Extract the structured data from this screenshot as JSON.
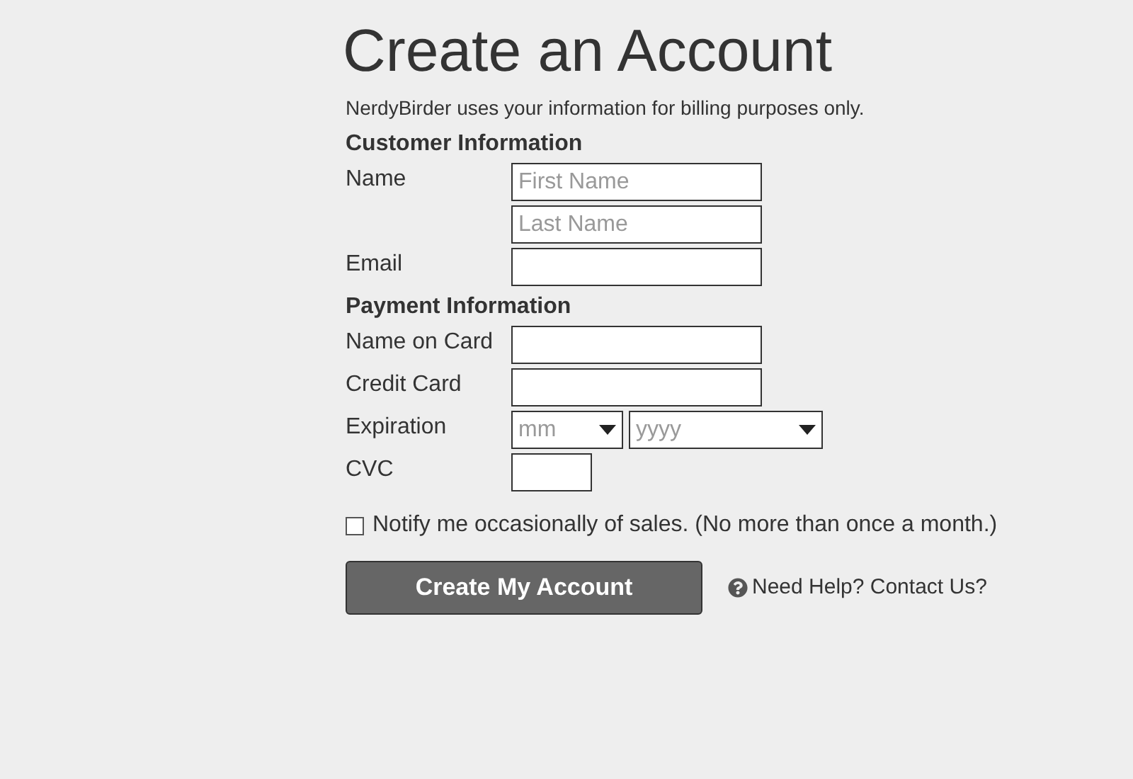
{
  "title": "Create an Account",
  "intro": "NerdyBirder uses your information for billing purposes only.",
  "sections": [
    {
      "heading": "Customer Information",
      "rows": [
        {
          "label": "Name",
          "inputs": [
            {
              "kind": "text",
              "placeholder": "First Name"
            }
          ]
        },
        {
          "inputs": [
            {
              "kind": "text",
              "placeholder": "Last Name"
            }
          ]
        },
        {
          "label": "Email",
          "inputs": [
            {
              "kind": "text"
            }
          ]
        }
      ]
    },
    {
      "heading": "Payment Information",
      "rows": [
        {
          "label": "Name on Card",
          "inputs": [
            {
              "kind": "text"
            }
          ]
        },
        {
          "label": "Credit Card",
          "inputs": [
            {
              "kind": "text"
            }
          ]
        },
        {
          "label": "Expiration",
          "inputs": [
            {
              "kind": "select",
              "value": "mm"
            },
            {
              "kind": "wide-select",
              "value": "yyyy"
            }
          ]
        },
        {
          "label": "CVC",
          "inputs": [
            {
              "kind": "short"
            }
          ]
        }
      ]
    }
  ],
  "notify": {
    "label": "Notify me occasionally of sales. (No more than once a month.)",
    "checked": false
  },
  "submit": "Create My Account",
  "help": "Need Help? Contact Us?"
}
